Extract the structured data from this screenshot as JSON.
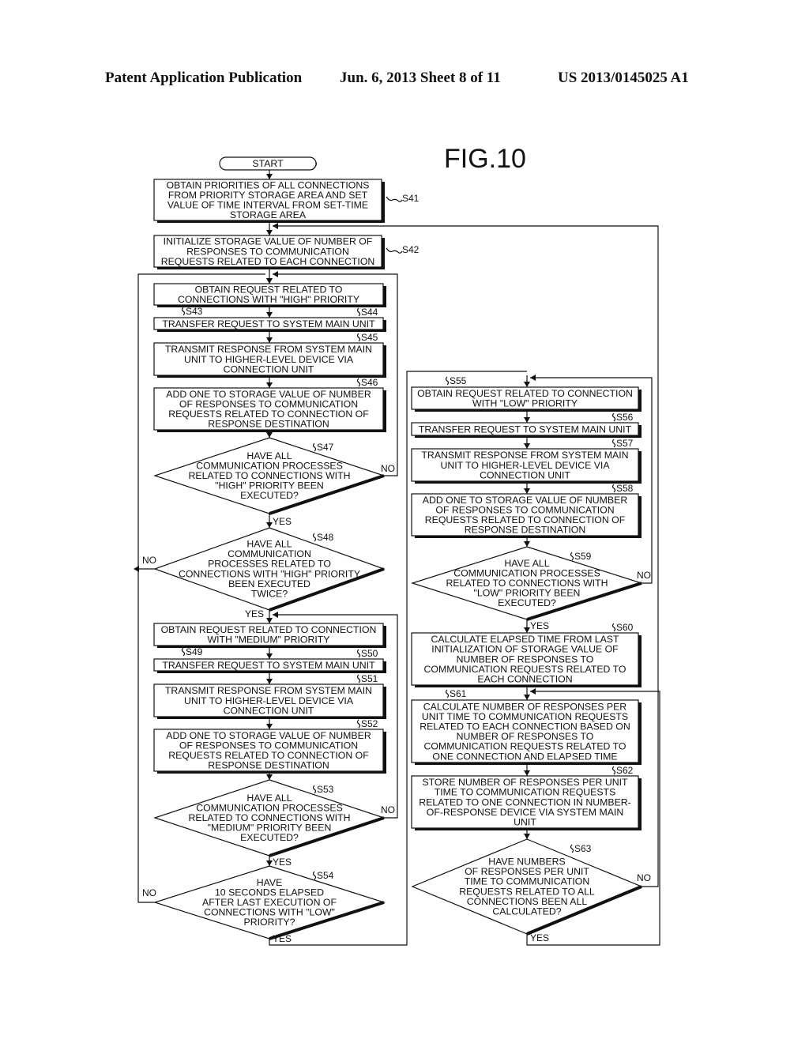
{
  "header": {
    "publication": "Patent Application Publication",
    "date_sheet": "Jun. 6, 2013   Sheet 8 of 11",
    "number": "US 2013/0145025 A1"
  },
  "figure_label": "FIG.10",
  "start_label": "START",
  "branch_labels": {
    "yes": "YES",
    "no": "NO"
  },
  "steps": {
    "S41": {
      "id": "S41",
      "lines": [
        "OBTAIN PRIORITIES OF ALL CONNECTIONS",
        "FROM PRIORITY STORAGE AREA AND SET",
        "VALUE OF TIME INTERVAL FROM SET-TIME",
        "STORAGE AREA"
      ]
    },
    "S42": {
      "id": "S42",
      "lines": [
        "INITIALIZE STORAGE VALUE OF NUMBER OF",
        "RESPONSES TO COMMUNICATION",
        "REQUESTS RELATED TO EACH CONNECTION"
      ]
    },
    "S43": {
      "id": "S43",
      "lines": [
        "OBTAIN REQUEST RELATED TO",
        "CONNECTIONS WITH \"HIGH\" PRIORITY"
      ]
    },
    "S44": {
      "id": "S44",
      "lines": [
        "TRANSFER REQUEST TO SYSTEM MAIN UNIT"
      ]
    },
    "S45": {
      "id": "S45",
      "lines": [
        "TRANSMIT RESPONSE FROM SYSTEM MAIN",
        "UNIT TO HIGHER-LEVEL DEVICE VIA",
        "CONNECTION UNIT"
      ]
    },
    "S46": {
      "id": "S46",
      "lines": [
        "ADD ONE TO STORAGE VALUE OF NUMBER",
        "OF RESPONSES TO COMMUNICATION",
        "REQUESTS RELATED TO CONNECTION OF",
        "RESPONSE DESTINATION"
      ]
    },
    "S47": {
      "id": "S47",
      "lines": [
        "HAVE ALL",
        "COMMUNICATION PROCESSES",
        "RELATED TO CONNECTIONS WITH",
        "\"HIGH\" PRIORITY BEEN",
        "EXECUTED?"
      ]
    },
    "S48": {
      "id": "S48",
      "lines": [
        "HAVE ALL",
        "COMMUNICATION",
        "PROCESSES RELATED TO",
        "CONNECTIONS WITH \"HIGH\" PRIORITY",
        "BEEN EXECUTED",
        "TWICE?"
      ]
    },
    "S49": {
      "id": "S49",
      "lines": [
        "OBTAIN REQUEST RELATED TO CONNECTION",
        "WITH \"MEDIUM\" PRIORITY"
      ]
    },
    "S50": {
      "id": "S50",
      "lines": [
        "TRANSFER REQUEST TO SYSTEM MAIN UNIT"
      ]
    },
    "S51": {
      "id": "S51",
      "lines": [
        "TRANSMIT RESPONSE FROM SYSTEM MAIN",
        "UNIT TO HIGHER-LEVEL DEVICE VIA",
        "CONNECTION UNIT"
      ]
    },
    "S52": {
      "id": "S52",
      "lines": [
        "ADD ONE TO STORAGE VALUE OF NUMBER",
        "OF RESPONSES TO COMMUNICATION",
        "REQUESTS RELATED TO CONNECTION OF",
        "RESPONSE DESTINATION"
      ]
    },
    "S53": {
      "id": "S53",
      "lines": [
        "HAVE ALL",
        "COMMUNICATION PROCESSES",
        "RELATED TO CONNECTIONS WITH",
        "\"MEDIUM\" PRIORITY BEEN",
        "EXECUTED?"
      ]
    },
    "S54": {
      "id": "S54",
      "lines": [
        "HAVE",
        "10 SECONDS ELAPSED",
        "AFTER LAST EXECUTION OF",
        "CONNECTIONS WITH \"LOW\"",
        "PRIORITY?"
      ]
    },
    "S55": {
      "id": "S55",
      "lines": [
        "OBTAIN REQUEST RELATED TO CONNECTION",
        "WITH \"LOW\" PRIORITY"
      ]
    },
    "S56": {
      "id": "S56",
      "lines": [
        "TRANSFER REQUEST TO SYSTEM MAIN UNIT"
      ]
    },
    "S57": {
      "id": "S57",
      "lines": [
        "TRANSMIT RESPONSE FROM SYSTEM MAIN",
        "UNIT TO HIGHER-LEVEL DEVICE VIA",
        "CONNECTION UNIT"
      ]
    },
    "S58": {
      "id": "S58",
      "lines": [
        "ADD ONE TO STORAGE VALUE OF NUMBER",
        "OF RESPONSES TO COMMUNICATION",
        "REQUESTS RELATED TO CONNECTION OF",
        "RESPONSE DESTINATION"
      ]
    },
    "S59": {
      "id": "S59",
      "lines": [
        "HAVE ALL",
        "COMMUNICATION PROCESSES",
        "RELATED TO CONNECTIONS WITH",
        "\"LOW\" PRIORITY BEEN",
        "EXECUTED?"
      ]
    },
    "S60": {
      "id": "S60",
      "lines": [
        "CALCULATE ELAPSED TIME FROM LAST",
        "INITIALIZATION OF STORAGE VALUE OF",
        "NUMBER OF RESPONSES TO",
        "COMMUNICATION REQUESTS RELATED TO",
        "EACH CONNECTION"
      ]
    },
    "S61": {
      "id": "S61",
      "lines": [
        "CALCULATE NUMBER OF RESPONSES PER",
        "UNIT TIME TO COMMUNICATION REQUESTS",
        "RELATED TO EACH CONNECTION BASED ON",
        "NUMBER OF RESPONSES TO",
        "COMMUNICATION REQUESTS RELATED TO",
        "ONE CONNECTION AND ELAPSED TIME"
      ]
    },
    "S62": {
      "id": "S62",
      "lines": [
        "STORE NUMBER OF RESPONSES PER UNIT",
        "TIME TO COMMUNICATION REQUESTS",
        "RELATED TO ONE CONNECTION IN NUMBER-",
        "OF-RESPONSE DEVICE VIA SYSTEM MAIN",
        "UNIT"
      ]
    },
    "S63": {
      "id": "S63",
      "lines": [
        "HAVE NUMBERS",
        "OF RESPONSES PER UNIT",
        "TIME TO COMMUNICATION",
        "REQUESTS RELATED TO ALL",
        "CONNECTIONS BEEN ALL",
        "CALCULATED?"
      ]
    }
  }
}
